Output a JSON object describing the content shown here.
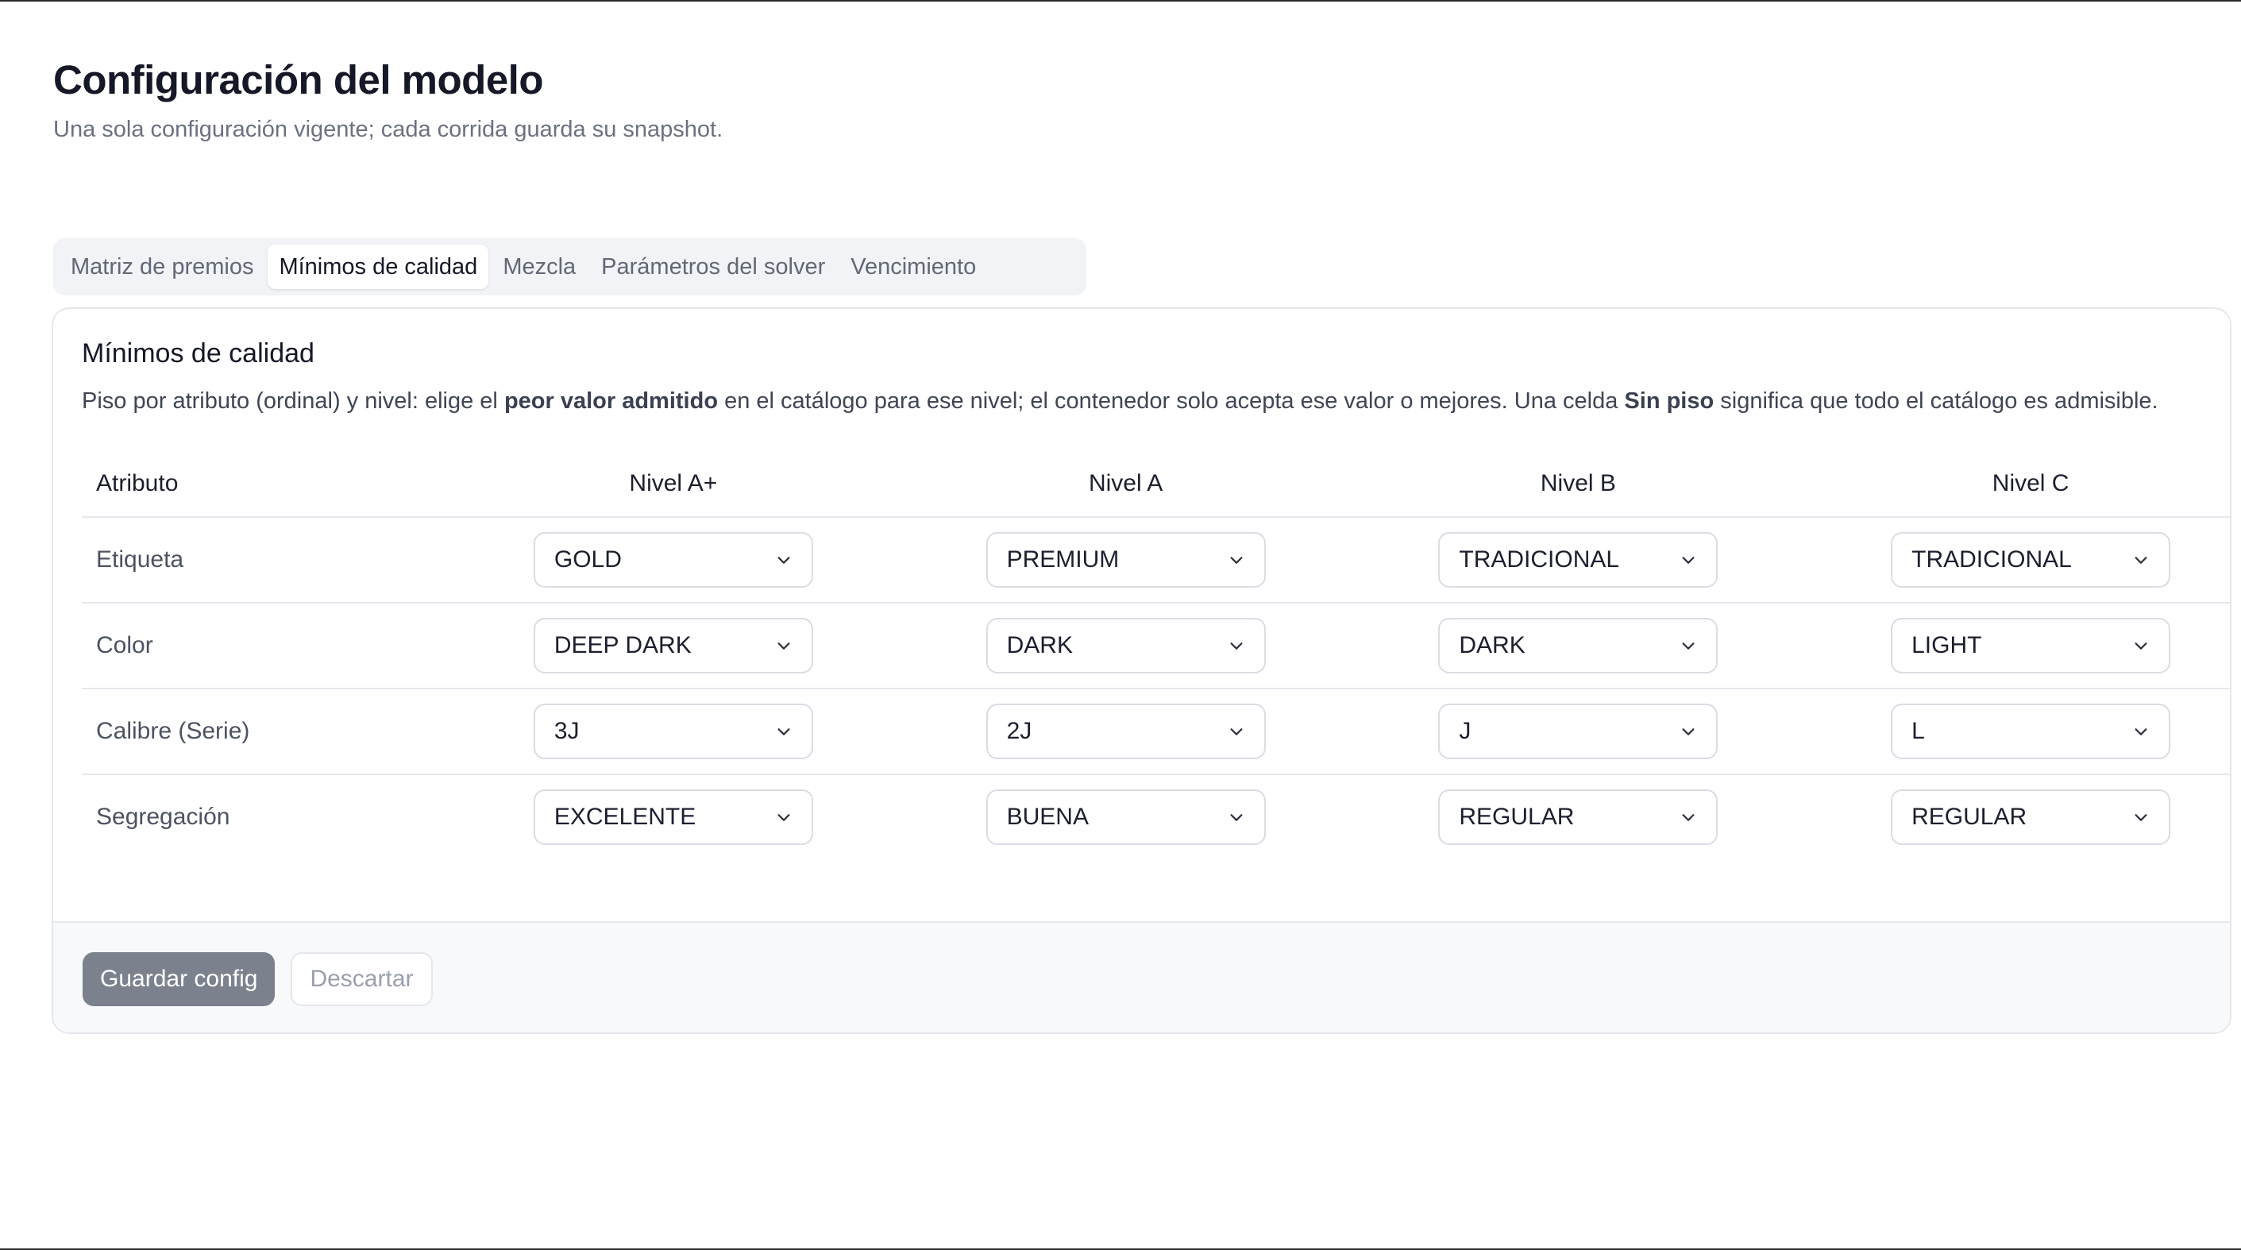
{
  "page": {
    "title": "Configuración del modelo",
    "subtitle": "Una sola configuración vigente; cada corrida guarda su snapshot."
  },
  "tabs": [
    {
      "label": "Matriz de premios",
      "active": false
    },
    {
      "label": "Mínimos de calidad",
      "active": true
    },
    {
      "label": "Mezcla",
      "active": false
    },
    {
      "label": "Parámetros del solver",
      "active": false
    },
    {
      "label": "Vencimiento",
      "active": false
    }
  ],
  "card": {
    "title": "Mínimos de calidad",
    "desc_part1": "Piso por atributo (ordinal) y nivel: elige el ",
    "desc_bold1": "peor valor admitido",
    "desc_part2": " en el catálogo para ese nivel; el contenedor solo acepta ese valor o mejores. Una celda ",
    "desc_bold2": "Sin piso",
    "desc_part3": " significa que todo el catálogo es admisible."
  },
  "table": {
    "headers": [
      "Atributo",
      "Nivel A+",
      "Nivel A",
      "Nivel B",
      "Nivel C"
    ],
    "rows": [
      {
        "attribute": "Etiqueta",
        "values": [
          "GOLD",
          "PREMIUM",
          "TRADICIONAL",
          "TRADICIONAL"
        ]
      },
      {
        "attribute": "Color",
        "values": [
          "DEEP DARK",
          "DARK",
          "DARK",
          "LIGHT"
        ]
      },
      {
        "attribute": "Calibre (Serie)",
        "values": [
          "3J",
          "2J",
          "J",
          "L"
        ]
      },
      {
        "attribute": "Segregación",
        "values": [
          "EXCELENTE",
          "BUENA",
          "REGULAR",
          "REGULAR"
        ]
      }
    ]
  },
  "footer": {
    "save_label": "Guardar config",
    "discard_label": "Descartar"
  },
  "icons": {
    "select_chevron": "chevron-down-icon"
  }
}
